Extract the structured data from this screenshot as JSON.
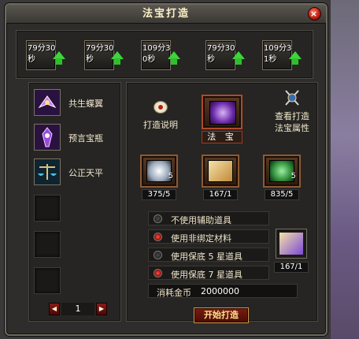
{
  "window": {
    "title": "法宝打造",
    "close": "×"
  },
  "top_slots": [
    {
      "text": "79分30秒"
    },
    {
      "text": "79分30秒"
    },
    {
      "text": "109分30秒"
    },
    {
      "text": "79分30秒"
    },
    {
      "text": "109分31秒"
    }
  ],
  "left_list": [
    {
      "label": "共生蝶翼",
      "icon": "butterfly-wing-icon"
    },
    {
      "label": "预言宝瓶",
      "icon": "prophecy-vase-icon"
    },
    {
      "label": "公正天平",
      "icon": "justice-scale-icon"
    }
  ],
  "pager": {
    "page": "1",
    "prev": "◀",
    "next": "▶"
  },
  "explain": {
    "label": "打造说明"
  },
  "main_slot": {
    "caption": "法 宝"
  },
  "attr": {
    "line1": "查看打造",
    "line2": "法宝属性"
  },
  "materials": [
    {
      "qty": "5",
      "count": "375/5",
      "color": "#cdd9e8"
    },
    {
      "qty": "",
      "count": "167/1",
      "color": "#e8c27a"
    },
    {
      "qty": "5",
      "count": "835/5",
      "color": "#2f8a3a"
    }
  ],
  "options": [
    {
      "label": "不使用辅助道具",
      "selected": false
    },
    {
      "label": "使用非绑定材料",
      "selected": true
    },
    {
      "label": "使用保底 5 星道具",
      "selected": false
    },
    {
      "label": "使用保底 7 星道具",
      "selected": true
    }
  ],
  "side_item": {
    "count": "167/1"
  },
  "cost": {
    "label": "消耗金币",
    "value": "2000000"
  },
  "start_button": {
    "label": "开始打造"
  }
}
